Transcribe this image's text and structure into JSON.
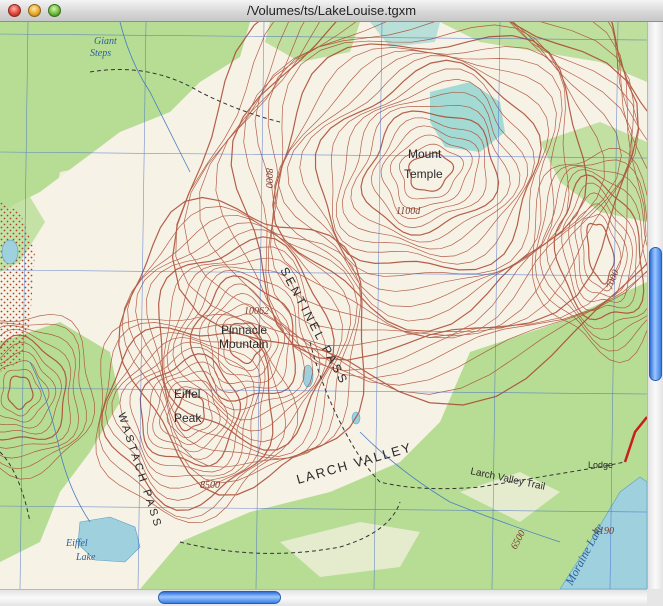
{
  "window": {
    "title": "/Volumes/ts/LakeLouise.tgxm"
  },
  "map": {
    "features": {
      "mount_temple": "Mount Temple",
      "mount_temple_line1": "Mount",
      "mount_temple_line2": "Temple",
      "pinnacle_line1": "Pinnacle",
      "pinnacle_line2": "Mountain",
      "pinnacle_elev": "10062",
      "eiffel_peak_line1": "Eiffel",
      "eiffel_peak_line2": "Peak",
      "sentinel_pass": "SENTINEL PASS",
      "wastach_pass": "WASTACH PASS",
      "larch_valley": "LARCH VALLEY",
      "larch_valley_trail": "Larch Valley Trail",
      "lodge": "Lodge",
      "eiffel_lake_line1": "Eiffel",
      "eiffel_lake_line2": "Lake",
      "moraine_lake": "Moraine Lake",
      "giant_steps_line1": "Giant",
      "giant_steps_line2": "Steps"
    },
    "elevations": {
      "e8000": "8000",
      "e11000": "1100d",
      "e7000": "7000",
      "e8500": "8500",
      "e6500": "6500",
      "e6190": "6190"
    },
    "colors": {
      "paper": "#f7f2e6",
      "forest": "#b7dd95",
      "contour": "#a8462e",
      "water": "#9fd0de",
      "grid": "#3b62c9",
      "glacier": "#8ed3cf",
      "road": "#c81e1e"
    }
  },
  "scrollbars": {
    "vertical": {
      "position": 0.52,
      "visible_fraction": 0.25
    },
    "horizontal": {
      "position": 0.29,
      "visible_fraction": 0.2
    }
  }
}
